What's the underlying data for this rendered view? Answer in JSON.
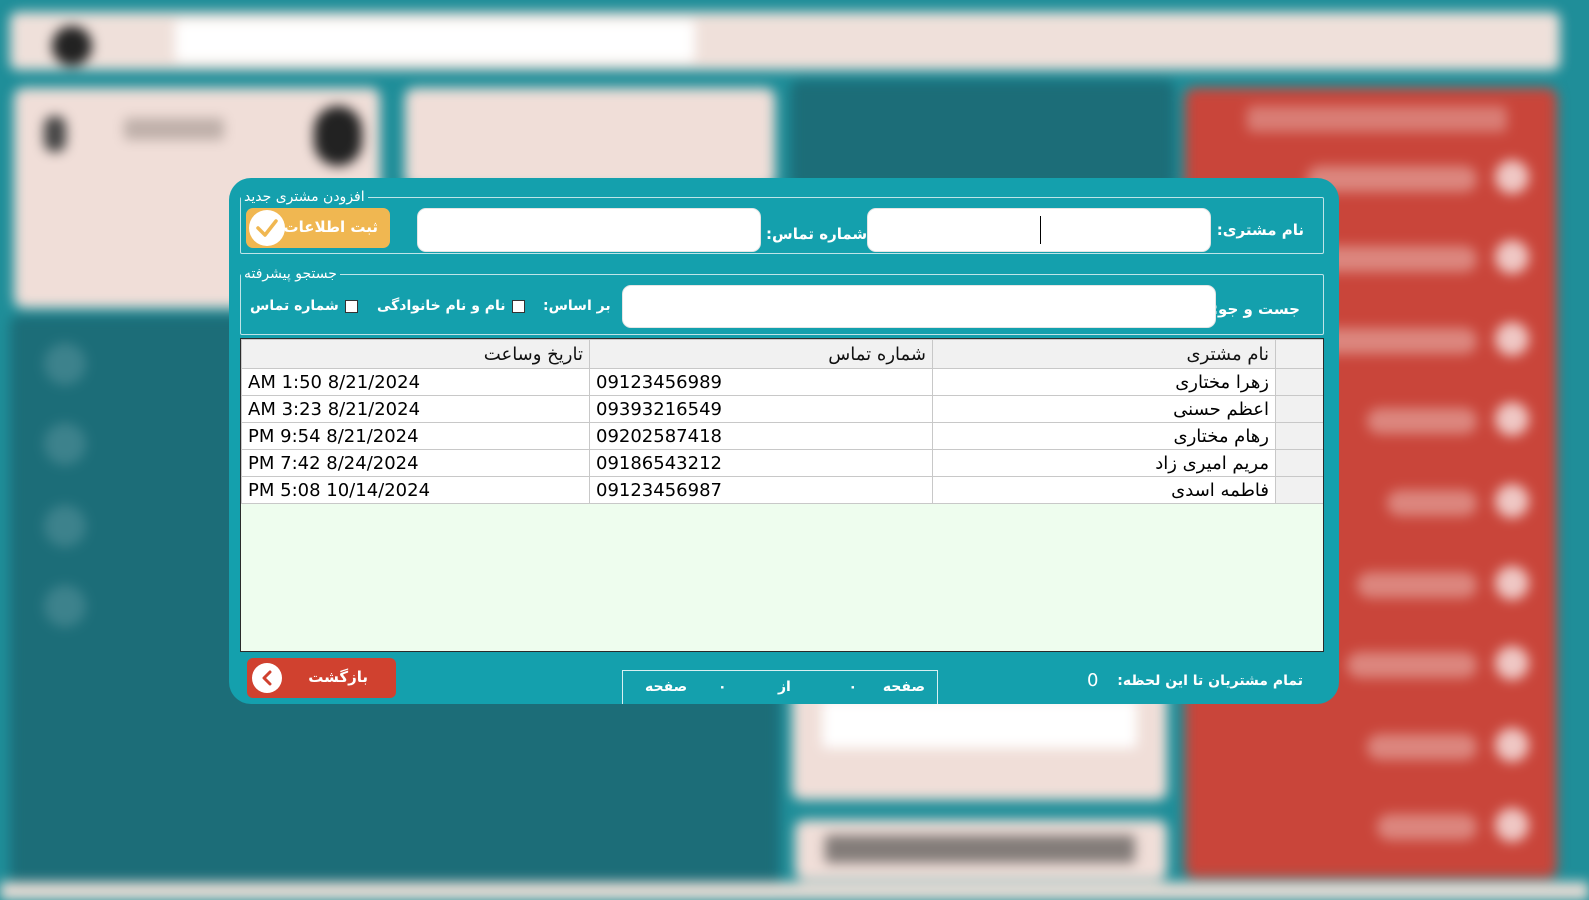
{
  "dialog": {
    "add_group_legend": "افزودن مشتری جدید",
    "customer_name_label": "نام مشتری:",
    "customer_name_value": "",
    "phone_label": "شماره تماس:",
    "phone_value": "",
    "save_button_label": "ثبت اطلاعات",
    "search_group_legend": "جستجو پیشرفته",
    "search_label": "جست و جو:",
    "search_value": "",
    "based_on_label": "بر اساس:",
    "filter_name_label": "نام و نام خانوادگی",
    "filter_phone_label": "شماره تماس"
  },
  "table": {
    "columns": [
      "نام مشتری",
      "شماره تماس",
      "تاریخ وساعت"
    ],
    "rows": [
      {
        "name": "زهرا مختاری",
        "phone": "09123456989",
        "datetime": "8/21/2024 1:50 AM"
      },
      {
        "name": "اعظم حسنی",
        "phone": "09393216549",
        "datetime": "8/21/2024 3:23 AM"
      },
      {
        "name": "رهام مختاری",
        "phone": "09202587418",
        "datetime": "8/21/2024 9:54 PM"
      },
      {
        "name": "مریم امیری زاد",
        "phone": "09186543212",
        "datetime": "8/24/2024 7:42 PM"
      },
      {
        "name": "فاطمه اسدی",
        "phone": "09123456987",
        "datetime": "10/14/2024 5:08 PM"
      }
    ]
  },
  "footer": {
    "back_button_label": "بازگشت",
    "page_word_1": "صفحه",
    "page_current": "۰",
    "of_word": "از",
    "page_total": "۰",
    "page_word_2": "صفحه",
    "total_customers_label": "تمام مشتریان تا این لحظه:",
    "total_customers_value": "0"
  },
  "colors": {
    "dialog_bg": "#14a0ad",
    "save_button": "#f0b751",
    "back_button": "#d0412f",
    "grid_bg": "#eefdee"
  }
}
